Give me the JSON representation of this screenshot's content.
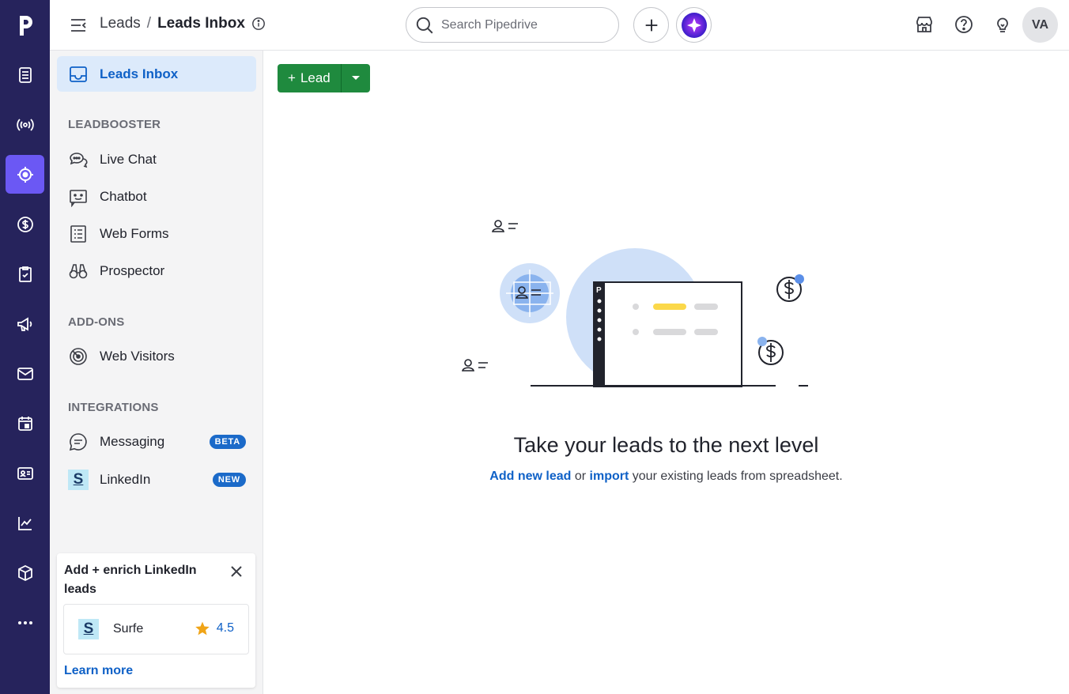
{
  "app": {
    "logo_letter": "p"
  },
  "rail": {
    "items": [
      {
        "name": "deals-icon"
      },
      {
        "name": "broadcast-icon"
      },
      {
        "name": "leads-icon"
      },
      {
        "name": "dollar-icon"
      },
      {
        "name": "activities-icon"
      },
      {
        "name": "campaigns-icon"
      },
      {
        "name": "mail-icon"
      },
      {
        "name": "calendar-icon"
      },
      {
        "name": "contacts-icon"
      },
      {
        "name": "insights-icon"
      },
      {
        "name": "products-icon"
      },
      {
        "name": "more-icon"
      }
    ],
    "active_index": 2
  },
  "header": {
    "breadcrumb_root": "Leads",
    "breadcrumb_sep": "/",
    "breadcrumb_current": "Leads Inbox",
    "search_placeholder": "Search Pipedrive",
    "avatar_initials": "VA"
  },
  "sidebar": {
    "inbox_label": "Leads Inbox",
    "sections": [
      {
        "heading": "LEADBOOSTER",
        "items": [
          {
            "label": "Live Chat"
          },
          {
            "label": "Chatbot"
          },
          {
            "label": "Web Forms"
          },
          {
            "label": "Prospector"
          }
        ]
      },
      {
        "heading": "ADD-ONS",
        "items": [
          {
            "label": "Web Visitors"
          }
        ]
      },
      {
        "heading": "INTEGRATIONS",
        "items": [
          {
            "label": "Messaging",
            "badge": "BETA"
          },
          {
            "label": "LinkedIn",
            "badge": "NEW",
            "logo_letter": "S"
          }
        ]
      }
    ],
    "promo": {
      "title": "Add + enrich LinkedIn leads",
      "app_name": "Surfe",
      "app_logo_letter": "S",
      "rating": "4.5",
      "learn_more": "Learn more"
    }
  },
  "main": {
    "add_lead_label": "Lead",
    "add_lead_plus": "+",
    "empty_title": "Take your leads to the next level",
    "empty_link_add": "Add new lead",
    "empty_or": " or ",
    "empty_link_import": "import",
    "empty_rest": " your existing leads from spreadsheet."
  },
  "colors": {
    "rail_bg": "#26235c",
    "rail_active": "#6b58f4",
    "primary_link": "#0f61c7",
    "add_button": "#1f8a3e",
    "sidebar_active_bg": "#dceafb"
  }
}
